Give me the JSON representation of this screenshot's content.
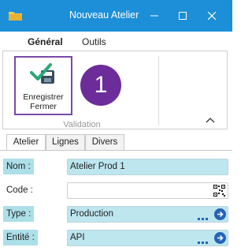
{
  "window": {
    "title": "Nouveau Atelier",
    "titlebar_color": "#1d8fd9",
    "app_icon": "folder-icon",
    "controls": [
      "minimize-icon",
      "maximize-icon",
      "close-icon"
    ]
  },
  "ribbon": {
    "tabs": [
      {
        "label": "Général",
        "active": true
      },
      {
        "label": "Outils",
        "active": false
      }
    ],
    "group_label": "Validation",
    "save_close_label": "Enregistrer Fermer",
    "badge_number": "1",
    "badge_color": "#6c2c99",
    "highlight_color": "#7a4aa8"
  },
  "form": {
    "tabs": [
      {
        "label": "Atelier",
        "active": true
      },
      {
        "label": "Lignes",
        "active": false
      },
      {
        "label": "Divers",
        "active": false
      }
    ],
    "fields": [
      {
        "label": "Nom :",
        "value": "Atelier Prod 1",
        "required": true
      },
      {
        "label": "Code :",
        "value": "",
        "required": false
      },
      {
        "label": "Type :",
        "value": "Production",
        "required": true
      },
      {
        "label": "Entité :",
        "value": "API",
        "required": true
      }
    ],
    "required_color": "#acdfe8",
    "lookup_arrow_color": "#2563b5"
  }
}
